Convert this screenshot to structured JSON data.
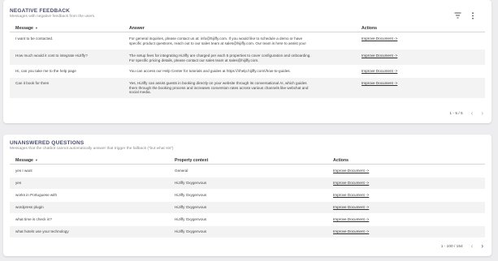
{
  "negative": {
    "title": "NEGATIVE FEEDBACK",
    "subtitle": "Messages with negative feedback from the users.",
    "columns": {
      "message": "Message",
      "answer": "Answer",
      "actions": "Actions"
    },
    "rows": [
      {
        "message": "I want to be contacted.",
        "answer_line1": "For general inquiries, please contact us at: info@hijiffy.com. If you would like to schedule a demo or have",
        "answer_line2": "specific product questions, reach out to our sales team at sales@hijiffy.com. Our team is here to assist you!",
        "action": "Improve Document ->"
      },
      {
        "message": "How much would it cost to integrate HiJiffy?",
        "answer_line1": "The setup fees for integrating HiJiffy are charged per each 5 properties to cover configuration and onboarding.",
        "answer_line2": "For specific pricing details, please contact our sales team at sales@hijiffy.com.",
        "action": "Improve Document ->"
      },
      {
        "message": "Hi, can you take me to the help page",
        "answer_line1": "You can access our Help Center for tutorials and guides at https:\\/\\/help.hijiffy.com\\/how-to-guides.",
        "answer_line2": "",
        "action": "Improve Document ->"
      },
      {
        "message": "Can it book for them",
        "answer_line1": "Yes, HiJiffy can assist guests in booking directly on your website through its conversational AI, which guides",
        "answer_line2": "them through the booking process and increases conversion rates across various channels like webchat and",
        "answer_line3": "social media.",
        "action": "Improve Document ->"
      }
    ],
    "pagination": "1 - 5 / 5"
  },
  "unanswered": {
    "title": "UNANSWERED QUESTIONS",
    "subtitle": "Messages that the chatbot cannot automatically answer that trigger the fallback (\"but what sts\")",
    "columns": {
      "message": "Message",
      "property": "Property context",
      "actions": "Actions"
    },
    "rows": [
      {
        "message": "yes I want",
        "property": "General",
        "action": "Improve Document ->"
      },
      {
        "message": "yes",
        "property": "HiJiffy Oxygenvous",
        "action": "Improve Document ->"
      },
      {
        "message": "works in Portuguese with",
        "property": "HiJiffy Oxygenvous",
        "action": "Improve Document ->"
      },
      {
        "message": "wordpress plugin",
        "property": "HiJiffy Oxygenvous",
        "action": "Improve Document ->"
      },
      {
        "message": "what time is check in?",
        "property": "HiJiffy Oxygenvous",
        "action": "Improve Document ->"
      },
      {
        "message": "what hotels use your technology",
        "property": "HiJiffy Oxygenvous",
        "action": "Improve Document ->"
      }
    ],
    "pagination": "1 - 100 / 154"
  }
}
